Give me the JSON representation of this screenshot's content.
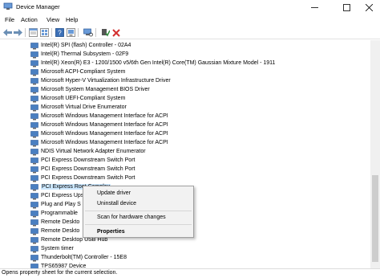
{
  "window": {
    "title": "Device Manager",
    "minimize_glyph": "—",
    "maximize_glyph": "☐",
    "close_glyph": "✕"
  },
  "menu": [
    "File",
    "Action",
    "View",
    "Help"
  ],
  "toolbar": {
    "icons": [
      "back-arrow-icon",
      "forward-arrow-icon",
      "properties-icon",
      "show-hidden-icon",
      "help-icon",
      "update-driver-icon",
      "scan-hardware-icon",
      "enable-device-icon",
      "uninstall-device-icon"
    ]
  },
  "tree": {
    "items": [
      "Intel(R) SPI (flash) Controller - 02A4",
      "Intel(R) Thermal Subsystem - 02F9",
      "Intel(R) Xeon(R) E3 - 1200/1500 v5/6th Gen Intel(R) Core(TM) Gaussian Mixture Model - 1911",
      "Microsoft ACPI-Compliant System",
      "Microsoft Hyper-V Virtualization Infrastructure Driver",
      "Microsoft System Management BIOS Driver",
      "Microsoft UEFI-Compliant System",
      "Microsoft Virtual Drive Enumerator",
      "Microsoft Windows Management Interface for ACPI",
      "Microsoft Windows Management Interface for ACPI",
      "Microsoft Windows Management Interface for ACPI",
      "Microsoft Windows Management Interface for ACPI",
      "NDIS Virtual Network Adapter Enumerator",
      "PCI Express Downstream Switch Port",
      "PCI Express Downstream Switch Port",
      "PCI Express Downstream Switch Port",
      "PCI Express Root Complex",
      "PCI Express Ups",
      "Plug and Play S",
      "Programmable",
      "Remote Deskto",
      "Remote Deskto",
      "Remote Desktop USB Hub",
      "System timer",
      "Thunderbolt(TM) Controller - 15E8",
      "TPS65987 Device"
    ],
    "selected_index": 16
  },
  "context_menu": {
    "items": [
      "Update driver",
      "Uninstall device",
      "Scan for hardware changes",
      "Properties"
    ]
  },
  "status": {
    "text": "Opens property sheet for the current selection."
  },
  "colors": {
    "selection": "#cce8ff",
    "device_icon": "#4a7fc1",
    "uninstall_red": "#d32f2f",
    "enable_green": "#2e8b3a"
  }
}
